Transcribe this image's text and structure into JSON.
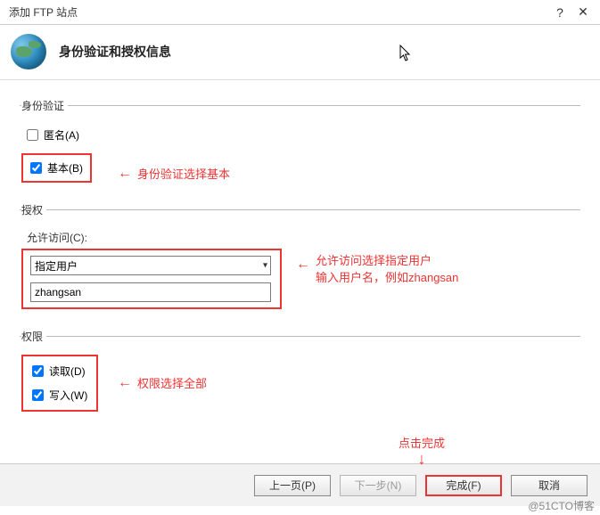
{
  "window": {
    "title": "添加 FTP 站点",
    "help_symbol": "?",
    "close_symbol": "✕"
  },
  "header": {
    "heading": "身份验证和授权信息"
  },
  "auth": {
    "legend": "身份验证",
    "anonymous": {
      "label": "匿名(A)",
      "checked": false
    },
    "basic": {
      "label": "基本(B)",
      "checked": true
    },
    "annotation": "身份验证选择基本"
  },
  "authorization": {
    "legend": "授权",
    "allow_access_label": "允许访问(C):",
    "selected_option": "指定用户",
    "username_value": "zhangsan",
    "annotation_line1": "允许访问选择指定用户",
    "annotation_line2": "输入用户名，例如zhangsan"
  },
  "permissions": {
    "legend": "权限",
    "read": {
      "label": "读取(D)",
      "checked": true
    },
    "write": {
      "label": "写入(W)",
      "checked": true
    },
    "annotation": "权限选择全部"
  },
  "buttons": {
    "prev": "上一页(P)",
    "next": "下一步(N)",
    "finish": "完成(F)",
    "cancel": "取消"
  },
  "finish_annotation": "点击完成",
  "watermark": "@51CTO博客"
}
